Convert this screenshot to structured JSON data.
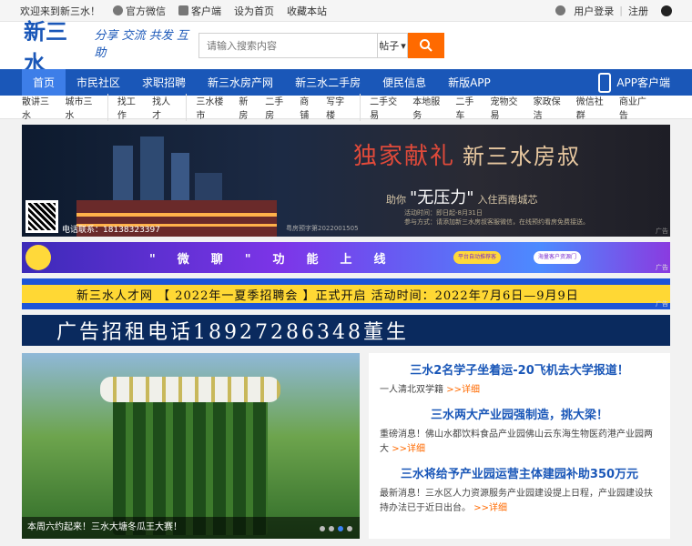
{
  "topbar": {
    "welcome": "欢迎来到新三水！",
    "wechat": "官方微信",
    "client": "客户端",
    "homepage": "设为首页",
    "favorite": "收藏本站",
    "login": "用户登录",
    "sep": "|",
    "register": "注册"
  },
  "header": {
    "logo": "新三水",
    "slogan": "分享 交流 共发 互助",
    "search_placeholder": "请输入搜索内容",
    "search_type": "帖子"
  },
  "nav": {
    "items": [
      "首页",
      "市民社区",
      "求职招聘",
      "新三水房产网",
      "新三水二手房",
      "便民信息",
      "新版APP"
    ],
    "app_label": "APP客户端"
  },
  "subnav": {
    "groups": [
      [
        "散讲三水",
        "城市三水"
      ],
      [
        "找工作",
        "找人才"
      ],
      [
        "三水楼市",
        "新房",
        "二手房",
        "商铺",
        "写字楼"
      ],
      [
        "二手交易",
        "本地服务",
        "二手车",
        "宠物交易",
        "家政保洁",
        "微信社群",
        "商业广告"
      ]
    ]
  },
  "banners": {
    "main_headline": "独家献礼",
    "main_sub": "新三水房叔",
    "main_line2_pre": "助你",
    "main_line2_big": "\"无压力\"",
    "main_line2_post": "入住西南城芯",
    "main_line3": "参与方式：请添加新三水房叔客服微信，在线预约看房免费接送。",
    "main_date": "活动时间：即日起-8月31日",
    "tel": "电话联系：18138323397",
    "code": "粤房预字第2022001505",
    "ad_tag": "广告",
    "weixin_text": "\"微聊\"功能上线",
    "weixin_b1": "平台自动推荐客",
    "weixin_b2": "海量客户资源门",
    "job_text": "新三水人才网 【 2022年一夏季招聘会 】正式开启 活动时间：2022年7月6日—9月9日",
    "phone_text": "广告招租电话18927286348董生"
  },
  "slider": {
    "caption": "本周六约起来！三水大塘冬瓜王大赛！",
    "dots": 4,
    "active": 2
  },
  "news": [
    {
      "title": "三水2名学子坐着运-20飞机去大学报道！",
      "desc": "一人清北双学籍",
      "more": ">>详细"
    },
    {
      "title": "三水两大产业园强制造，挑大梁！",
      "desc": "重磅消息！佛山水都饮料食品产业园佛山云东海生物医药港产业园两大",
      "more": ">>详细"
    },
    {
      "title": "三水将给予产业园运营主体建园补助350万元",
      "desc": "最新消息！三水区人力资源服务产业园建设提上日程，产业园建设扶持办法已于近日出台。",
      "more": ">>详细"
    }
  ],
  "colors": {
    "brand": "#1a57b8",
    "accent": "#ff6a00"
  }
}
